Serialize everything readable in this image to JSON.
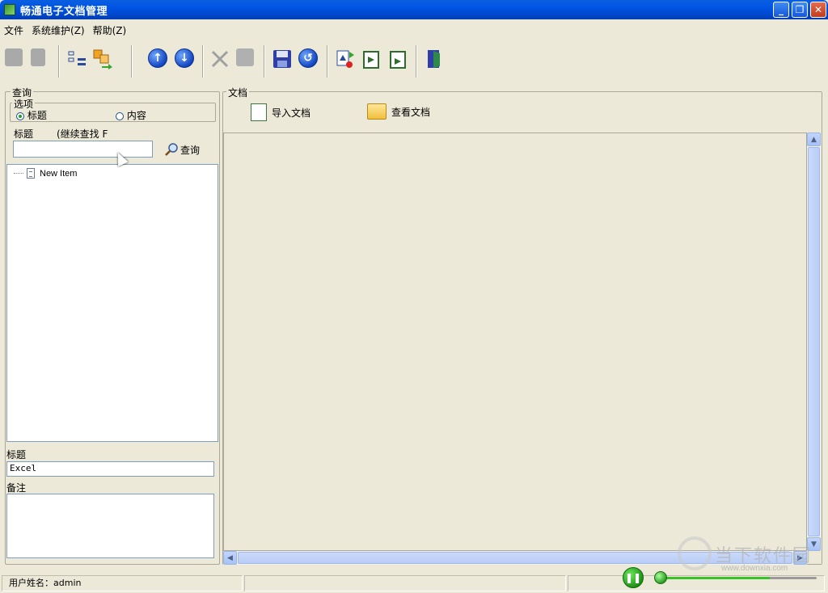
{
  "window": {
    "title": "畅通电子文档管理"
  },
  "menu": [
    {
      "label": "文件"
    },
    {
      "label": "系统维护(Z)"
    },
    {
      "label": "帮助(Z)"
    }
  ],
  "toolbar": {
    "icons": [
      "add-node-icon",
      "add-child-node-icon",
      "tree-structure-icon",
      "move-node-icon",
      "arrow-up-icon",
      "arrow-down-icon",
      "delete-icon",
      "edit-icon",
      "save-icon",
      "undo-icon",
      "document-import-icon",
      "document-export-icon",
      "document-refresh-icon",
      "exit-icon"
    ]
  },
  "query": {
    "group_title": "查询",
    "options_title": "选项",
    "radio_title": "标题",
    "radio_content": "内容",
    "title_label": "标题",
    "continue_search": "(继续查找 F",
    "search_value": "",
    "search_button": "查询"
  },
  "tree": {
    "items": [
      {
        "label": "New Item"
      }
    ]
  },
  "details": {
    "title_label": "标题",
    "title_value": "Excel",
    "notes_label": "备注",
    "notes_value": ""
  },
  "document": {
    "group_title": "文档",
    "import_button": "导入文档",
    "view_button": "查看文档"
  },
  "status": {
    "user_label": "用户姓名：admin"
  },
  "watermark": {
    "text": "当下软件园",
    "url": "www.downxia.com"
  }
}
